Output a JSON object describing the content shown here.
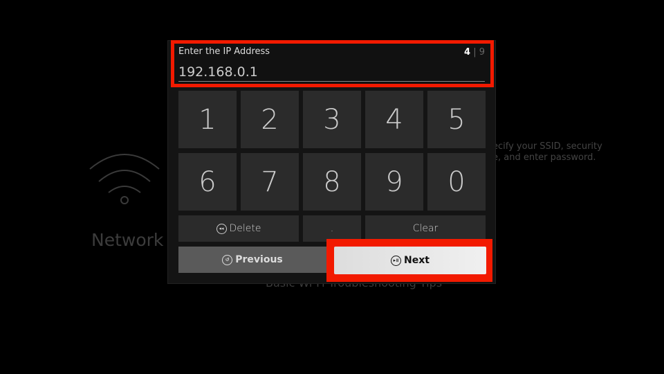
{
  "background": {
    "network_label": "Network",
    "description_lines": [
      "ecify your SSID, security",
      "e, and enter password."
    ],
    "tips_link": "Basic Wi-Fi Troubleshooting Tips"
  },
  "input": {
    "label": "Enter the IP Address",
    "value": "192.168.0.1",
    "step_current": "4",
    "step_separator": "|",
    "step_total": "9"
  },
  "keypad": {
    "row1": [
      "1",
      "2",
      "3",
      "4",
      "5"
    ],
    "row2": [
      "6",
      "7",
      "8",
      "9",
      "0"
    ],
    "delete_label": "Delete",
    "dot_label": ".",
    "clear_label": "Clear",
    "previous_label": "Previous",
    "next_label": "Next"
  },
  "colors": {
    "highlight": "#f21a00"
  }
}
